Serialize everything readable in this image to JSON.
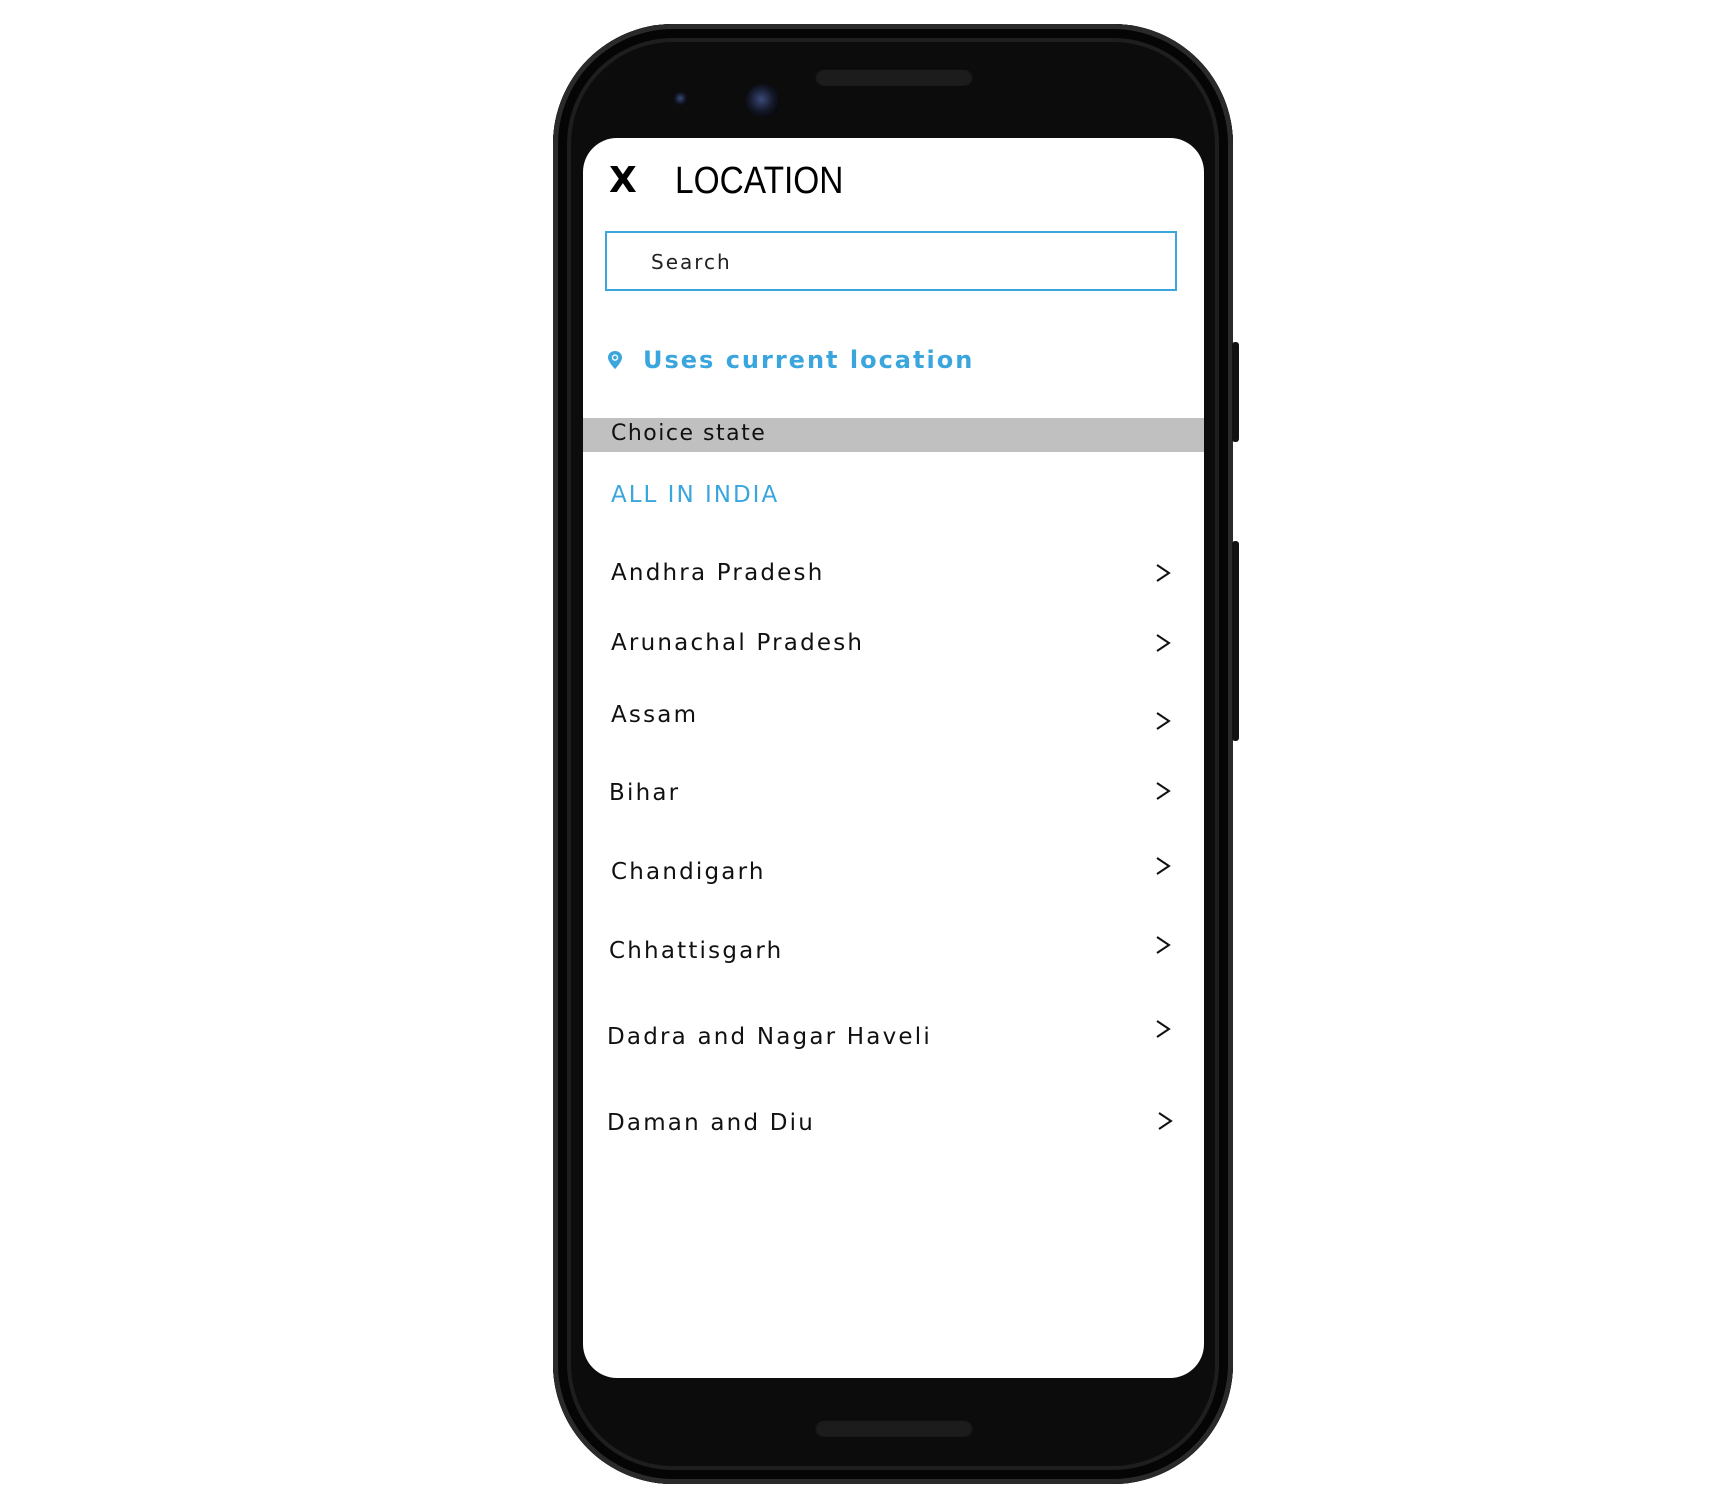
{
  "header": {
    "close_label": "X",
    "title": "LOCATION"
  },
  "search": {
    "placeholder": "Search",
    "value": ""
  },
  "current_location": {
    "label": "Uses current location",
    "icon": "location-pin-icon"
  },
  "section": {
    "label": "Choice state"
  },
  "all_option": {
    "label": "ALL IN INDIA"
  },
  "states": [
    {
      "label": "Andhra Pradesh"
    },
    {
      "label": "Arunachal Pradesh"
    },
    {
      "label": "Assam"
    },
    {
      "label": "Bihar"
    },
    {
      "label": "Chandigarh"
    },
    {
      "label": "Chhattisgarh"
    },
    {
      "label": "Dadra and Nagar Haveli"
    },
    {
      "label": "Daman and Diu"
    }
  ],
  "colors": {
    "accent": "#3aa6dd",
    "section_bg": "#c0c0c0",
    "text": "#111111",
    "device": "#0c0c0c"
  }
}
